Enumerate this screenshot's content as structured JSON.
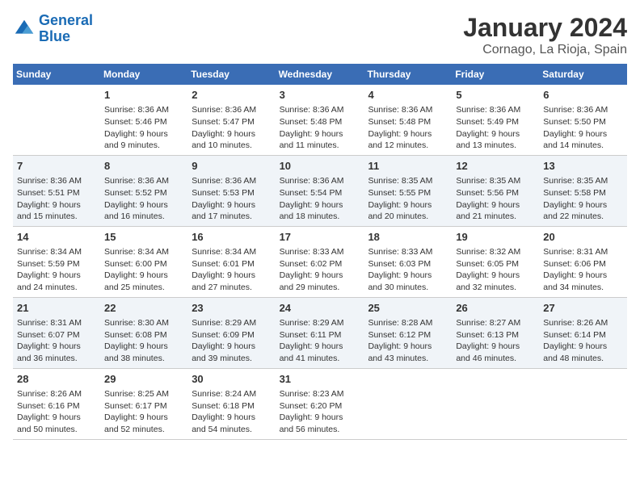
{
  "logo": {
    "line1": "General",
    "line2": "Blue"
  },
  "title": "January 2024",
  "subtitle": "Cornago, La Rioja, Spain",
  "days_header": [
    "Sunday",
    "Monday",
    "Tuesday",
    "Wednesday",
    "Thursday",
    "Friday",
    "Saturday"
  ],
  "weeks": [
    [
      {
        "num": "",
        "text": ""
      },
      {
        "num": "1",
        "text": "Sunrise: 8:36 AM\nSunset: 5:46 PM\nDaylight: 9 hours\nand 9 minutes."
      },
      {
        "num": "2",
        "text": "Sunrise: 8:36 AM\nSunset: 5:47 PM\nDaylight: 9 hours\nand 10 minutes."
      },
      {
        "num": "3",
        "text": "Sunrise: 8:36 AM\nSunset: 5:48 PM\nDaylight: 9 hours\nand 11 minutes."
      },
      {
        "num": "4",
        "text": "Sunrise: 8:36 AM\nSunset: 5:48 PM\nDaylight: 9 hours\nand 12 minutes."
      },
      {
        "num": "5",
        "text": "Sunrise: 8:36 AM\nSunset: 5:49 PM\nDaylight: 9 hours\nand 13 minutes."
      },
      {
        "num": "6",
        "text": "Sunrise: 8:36 AM\nSunset: 5:50 PM\nDaylight: 9 hours\nand 14 minutes."
      }
    ],
    [
      {
        "num": "7",
        "text": "Sunrise: 8:36 AM\nSunset: 5:51 PM\nDaylight: 9 hours\nand 15 minutes."
      },
      {
        "num": "8",
        "text": "Sunrise: 8:36 AM\nSunset: 5:52 PM\nDaylight: 9 hours\nand 16 minutes."
      },
      {
        "num": "9",
        "text": "Sunrise: 8:36 AM\nSunset: 5:53 PM\nDaylight: 9 hours\nand 17 minutes."
      },
      {
        "num": "10",
        "text": "Sunrise: 8:36 AM\nSunset: 5:54 PM\nDaylight: 9 hours\nand 18 minutes."
      },
      {
        "num": "11",
        "text": "Sunrise: 8:35 AM\nSunset: 5:55 PM\nDaylight: 9 hours\nand 20 minutes."
      },
      {
        "num": "12",
        "text": "Sunrise: 8:35 AM\nSunset: 5:56 PM\nDaylight: 9 hours\nand 21 minutes."
      },
      {
        "num": "13",
        "text": "Sunrise: 8:35 AM\nSunset: 5:58 PM\nDaylight: 9 hours\nand 22 minutes."
      }
    ],
    [
      {
        "num": "14",
        "text": "Sunrise: 8:34 AM\nSunset: 5:59 PM\nDaylight: 9 hours\nand 24 minutes."
      },
      {
        "num": "15",
        "text": "Sunrise: 8:34 AM\nSunset: 6:00 PM\nDaylight: 9 hours\nand 25 minutes."
      },
      {
        "num": "16",
        "text": "Sunrise: 8:34 AM\nSunset: 6:01 PM\nDaylight: 9 hours\nand 27 minutes."
      },
      {
        "num": "17",
        "text": "Sunrise: 8:33 AM\nSunset: 6:02 PM\nDaylight: 9 hours\nand 29 minutes."
      },
      {
        "num": "18",
        "text": "Sunrise: 8:33 AM\nSunset: 6:03 PM\nDaylight: 9 hours\nand 30 minutes."
      },
      {
        "num": "19",
        "text": "Sunrise: 8:32 AM\nSunset: 6:05 PM\nDaylight: 9 hours\nand 32 minutes."
      },
      {
        "num": "20",
        "text": "Sunrise: 8:31 AM\nSunset: 6:06 PM\nDaylight: 9 hours\nand 34 minutes."
      }
    ],
    [
      {
        "num": "21",
        "text": "Sunrise: 8:31 AM\nSunset: 6:07 PM\nDaylight: 9 hours\nand 36 minutes."
      },
      {
        "num": "22",
        "text": "Sunrise: 8:30 AM\nSunset: 6:08 PM\nDaylight: 9 hours\nand 38 minutes."
      },
      {
        "num": "23",
        "text": "Sunrise: 8:29 AM\nSunset: 6:09 PM\nDaylight: 9 hours\nand 39 minutes."
      },
      {
        "num": "24",
        "text": "Sunrise: 8:29 AM\nSunset: 6:11 PM\nDaylight: 9 hours\nand 41 minutes."
      },
      {
        "num": "25",
        "text": "Sunrise: 8:28 AM\nSunset: 6:12 PM\nDaylight: 9 hours\nand 43 minutes."
      },
      {
        "num": "26",
        "text": "Sunrise: 8:27 AM\nSunset: 6:13 PM\nDaylight: 9 hours\nand 46 minutes."
      },
      {
        "num": "27",
        "text": "Sunrise: 8:26 AM\nSunset: 6:14 PM\nDaylight: 9 hours\nand 48 minutes."
      }
    ],
    [
      {
        "num": "28",
        "text": "Sunrise: 8:26 AM\nSunset: 6:16 PM\nDaylight: 9 hours\nand 50 minutes."
      },
      {
        "num": "29",
        "text": "Sunrise: 8:25 AM\nSunset: 6:17 PM\nDaylight: 9 hours\nand 52 minutes."
      },
      {
        "num": "30",
        "text": "Sunrise: 8:24 AM\nSunset: 6:18 PM\nDaylight: 9 hours\nand 54 minutes."
      },
      {
        "num": "31",
        "text": "Sunrise: 8:23 AM\nSunset: 6:20 PM\nDaylight: 9 hours\nand 56 minutes."
      },
      {
        "num": "",
        "text": ""
      },
      {
        "num": "",
        "text": ""
      },
      {
        "num": "",
        "text": ""
      }
    ]
  ]
}
